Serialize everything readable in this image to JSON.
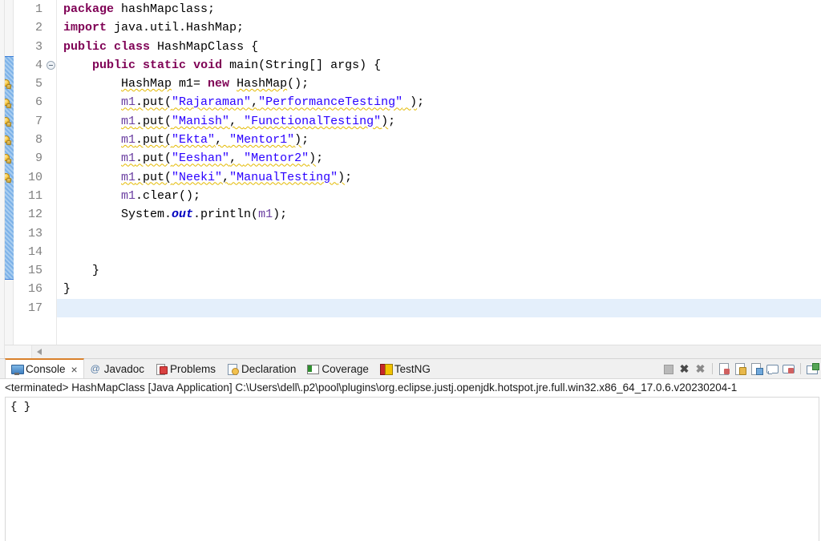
{
  "editor": {
    "current_line": 17,
    "total_visible_lines": 17,
    "fold_line": 4,
    "warning_lines": [
      5,
      6,
      7,
      8,
      9,
      10
    ],
    "changed_lines_range": [
      4,
      15
    ],
    "lines": [
      {
        "n": 1,
        "tokens": [
          {
            "t": "kw",
            "v": "package"
          },
          {
            "t": "pln",
            "v": " hashMapclass;"
          }
        ]
      },
      {
        "n": 2,
        "tokens": [
          {
            "t": "kw",
            "v": "import"
          },
          {
            "t": "pln",
            "v": " java.util.HashMap;"
          }
        ]
      },
      {
        "n": 3,
        "tokens": [
          {
            "t": "kw",
            "v": "public"
          },
          {
            "t": "pln",
            "v": " "
          },
          {
            "t": "kw",
            "v": "class"
          },
          {
            "t": "pln",
            "v": " HashMapClass {"
          }
        ]
      },
      {
        "n": 4,
        "tokens": [
          {
            "t": "pln",
            "v": "    "
          },
          {
            "t": "kw",
            "v": "public"
          },
          {
            "t": "pln",
            "v": " "
          },
          {
            "t": "kw",
            "v": "static"
          },
          {
            "t": "pln",
            "v": " "
          },
          {
            "t": "kw",
            "v": "void"
          },
          {
            "t": "pln",
            "v": " main(String[] args) {"
          }
        ]
      },
      {
        "n": 5,
        "tokens": [
          {
            "t": "pln",
            "v": "        "
          },
          {
            "t": "pln warnu",
            "v": "HashMap"
          },
          {
            "t": "pln",
            "v": " m1= "
          },
          {
            "t": "kw",
            "v": "new"
          },
          {
            "t": "pln",
            "v": " "
          },
          {
            "t": "pln warnu",
            "v": "HashMap"
          },
          {
            "t": "pln",
            "v": "();"
          }
        ]
      },
      {
        "n": 6,
        "tokens": [
          {
            "t": "pln",
            "v": "        "
          },
          {
            "t": "lvar warnu",
            "v": "m1"
          },
          {
            "t": "pln warnu",
            "v": ".put("
          },
          {
            "t": "str warnu",
            "v": "\"Rajaraman\""
          },
          {
            "t": "pln warnu",
            "v": ","
          },
          {
            "t": "str warnu",
            "v": "\"PerformanceTesting\""
          },
          {
            "t": "pln warnu",
            "v": " )"
          },
          {
            "t": "pln",
            "v": ";"
          }
        ]
      },
      {
        "n": 7,
        "tokens": [
          {
            "t": "pln",
            "v": "        "
          },
          {
            "t": "lvar warnu",
            "v": "m1"
          },
          {
            "t": "pln warnu",
            "v": ".put("
          },
          {
            "t": "str warnu",
            "v": "\"Manish\""
          },
          {
            "t": "pln warnu",
            "v": ", "
          },
          {
            "t": "str warnu",
            "v": "\"FunctionalTesting\""
          },
          {
            "t": "pln warnu",
            "v": ")"
          },
          {
            "t": "pln",
            "v": ";"
          }
        ]
      },
      {
        "n": 8,
        "tokens": [
          {
            "t": "pln",
            "v": "        "
          },
          {
            "t": "lvar warnu",
            "v": "m1"
          },
          {
            "t": "pln warnu",
            "v": ".put("
          },
          {
            "t": "str warnu",
            "v": "\"Ekta\""
          },
          {
            "t": "pln warnu",
            "v": ", "
          },
          {
            "t": "str warnu",
            "v": "\"Mentor1\""
          },
          {
            "t": "pln warnu",
            "v": ")"
          },
          {
            "t": "pln",
            "v": ";"
          }
        ]
      },
      {
        "n": 9,
        "tokens": [
          {
            "t": "pln",
            "v": "        "
          },
          {
            "t": "lvar warnu",
            "v": "m1"
          },
          {
            "t": "pln warnu",
            "v": ".put("
          },
          {
            "t": "str warnu",
            "v": "\"Eeshan\""
          },
          {
            "t": "pln warnu",
            "v": ", "
          },
          {
            "t": "str warnu",
            "v": "\"Mentor2\""
          },
          {
            "t": "pln warnu",
            "v": ")"
          },
          {
            "t": "pln",
            "v": ";"
          }
        ]
      },
      {
        "n": 10,
        "tokens": [
          {
            "t": "pln",
            "v": "        "
          },
          {
            "t": "lvar warnu",
            "v": "m1"
          },
          {
            "t": "pln warnu",
            "v": ".put("
          },
          {
            "t": "str warnu",
            "v": "\"Neeki\""
          },
          {
            "t": "pln warnu",
            "v": ","
          },
          {
            "t": "str warnu",
            "v": "\"ManualTesting\""
          },
          {
            "t": "pln warnu",
            "v": ")"
          },
          {
            "t": "pln",
            "v": ";"
          }
        ]
      },
      {
        "n": 11,
        "tokens": [
          {
            "t": "pln",
            "v": "        "
          },
          {
            "t": "lvar",
            "v": "m1"
          },
          {
            "t": "pln",
            "v": ".clear();"
          }
        ]
      },
      {
        "n": 12,
        "tokens": [
          {
            "t": "pln",
            "v": "        System."
          },
          {
            "t": "sfld",
            "v": "out"
          },
          {
            "t": "pln",
            "v": ".println("
          },
          {
            "t": "lvar",
            "v": "m1"
          },
          {
            "t": "pln",
            "v": ");"
          }
        ]
      },
      {
        "n": 13,
        "tokens": [
          {
            "t": "pln",
            "v": ""
          }
        ]
      },
      {
        "n": 14,
        "tokens": [
          {
            "t": "pln",
            "v": ""
          }
        ]
      },
      {
        "n": 15,
        "tokens": [
          {
            "t": "pln",
            "v": "    }"
          }
        ]
      },
      {
        "n": 16,
        "tokens": [
          {
            "t": "pln",
            "v": "}"
          }
        ]
      },
      {
        "n": 17,
        "tokens": [
          {
            "t": "pln",
            "v": ""
          }
        ]
      }
    ],
    "scrollbar": {
      "left_arrow": "◀"
    }
  },
  "console_view": {
    "tabs": [
      {
        "label": "Console",
        "icon": "console-monitor-icon",
        "active": true,
        "closable": true,
        "close_glyph": "×"
      },
      {
        "label": "Javadoc",
        "icon": "javadoc-at-icon",
        "active": false,
        "closable": false
      },
      {
        "label": "Problems",
        "icon": "problems-icon",
        "active": false,
        "closable": false
      },
      {
        "label": "Declaration",
        "icon": "declaration-icon",
        "active": false,
        "closable": false
      },
      {
        "label": "Coverage",
        "icon": "coverage-icon",
        "active": false,
        "closable": false
      },
      {
        "label": "TestNG",
        "icon": "testng-icon",
        "active": false,
        "closable": false
      }
    ],
    "toolbar": [
      {
        "name": "terminate-button",
        "icon": "stop-square-icon",
        "disabled": true
      },
      {
        "name": "terminate-all-button",
        "icon": "x-mark-icon",
        "glyph": "✖"
      },
      {
        "name": "remove-all-terminated-button",
        "icon": "x-mark-faded-icon",
        "glyph": "✖"
      },
      {
        "name": "separator-1",
        "icon": "separator"
      },
      {
        "name": "clear-console-button",
        "icon": "clear-console-icon"
      },
      {
        "name": "scroll-lock-button",
        "icon": "scroll-lock-icon"
      },
      {
        "name": "word-wrap-button",
        "icon": "word-wrap-icon"
      },
      {
        "name": "show-console-on-output-button",
        "icon": "console-bubble-icon"
      },
      {
        "name": "show-console-on-error-button",
        "icon": "console-bubble-error-icon"
      },
      {
        "name": "separator-2",
        "icon": "separator"
      },
      {
        "name": "open-console-button",
        "icon": "new-console-icon"
      }
    ],
    "status_line": "<terminated> HashMapClass [Java Application] C:\\Users\\dell\\.p2\\pool\\plugins\\org.eclipse.justj.openjdk.hotspot.jre.full.win32.x86_64_17.0.6.v20230204-1",
    "output": "{ }"
  },
  "colors": {
    "keyword": "#7f0055",
    "string": "#2a00ff",
    "static_field": "#0000c0",
    "local_var": "#6a3ea1",
    "plain": "#000000",
    "warning_squiggle": "#e3b900",
    "current_line_highlight": "#e4effb",
    "changed_line_bar": "#7db2e8",
    "active_tab_accent": "#d9812c",
    "gutter_text": "#808080"
  }
}
